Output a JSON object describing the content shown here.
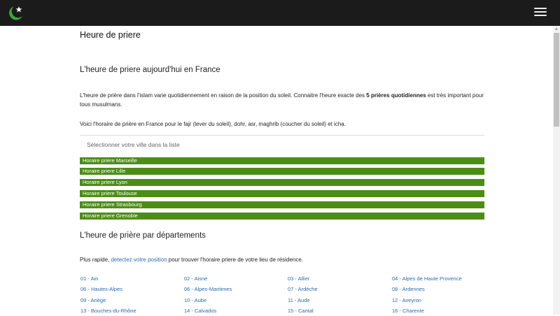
{
  "nav": {
    "logo_icon": "crescent-star-icon",
    "menu_icon": "hamburger-menu-icon",
    "background": "#1b1b1b"
  },
  "page_title": "Heure de priere",
  "section1": {
    "title": "L'heure de priere aujourd'hui en France",
    "intro_start": "L'heure de prière dans l'islam varie quotidiennement en raison de la position du soleil. Connaitre l'heure exacte des ",
    "intro_bold": "5 prières quotidiennes",
    "intro_end": " est très important pour tous musulmans.",
    "voici": "Voici l'horaire de prière en France pour le fajr (lever du soleil), dohr, asr, maghrib (coucher du soleil) et icha.",
    "select_label": "Sélectionner votre ville dans la liste"
  },
  "city_bars": [
    "Horaire priere Marseille",
    "Horaire priere Lille",
    "Horaire priere Lyon",
    "Horaire priere Toulouse",
    "Horaire priere Strasbourg",
    "Horaire priere Grenoble"
  ],
  "section2": {
    "title": "L'heure de prière par départements",
    "intro_prefix": "Plus rapide, ",
    "intro_link": "detectez votre position",
    "intro_suffix": " pour trouver l'horaire priere de votre lieu de résidence."
  },
  "departments": [
    [
      "01 - Ain",
      "06 - Hautes-Alpes",
      "09 - Ariège",
      "13 - Bouches-du-Rhône"
    ],
    [
      "02 - Aisne",
      "06 - Alpes-Maritimes",
      "10 - Aube",
      "14 - Calvados"
    ],
    [
      "03 - Allier",
      "07 - Ardèche",
      "11 - Aude",
      "15 - Cantal"
    ],
    [
      "04 - Alpes de Haute Provence",
      "08 - Ardennes",
      "12 - Aveyron",
      "16 - Charente"
    ]
  ],
  "colors": {
    "accent_green": "#4c8d16",
    "link_blue": "#2a6cb0"
  }
}
